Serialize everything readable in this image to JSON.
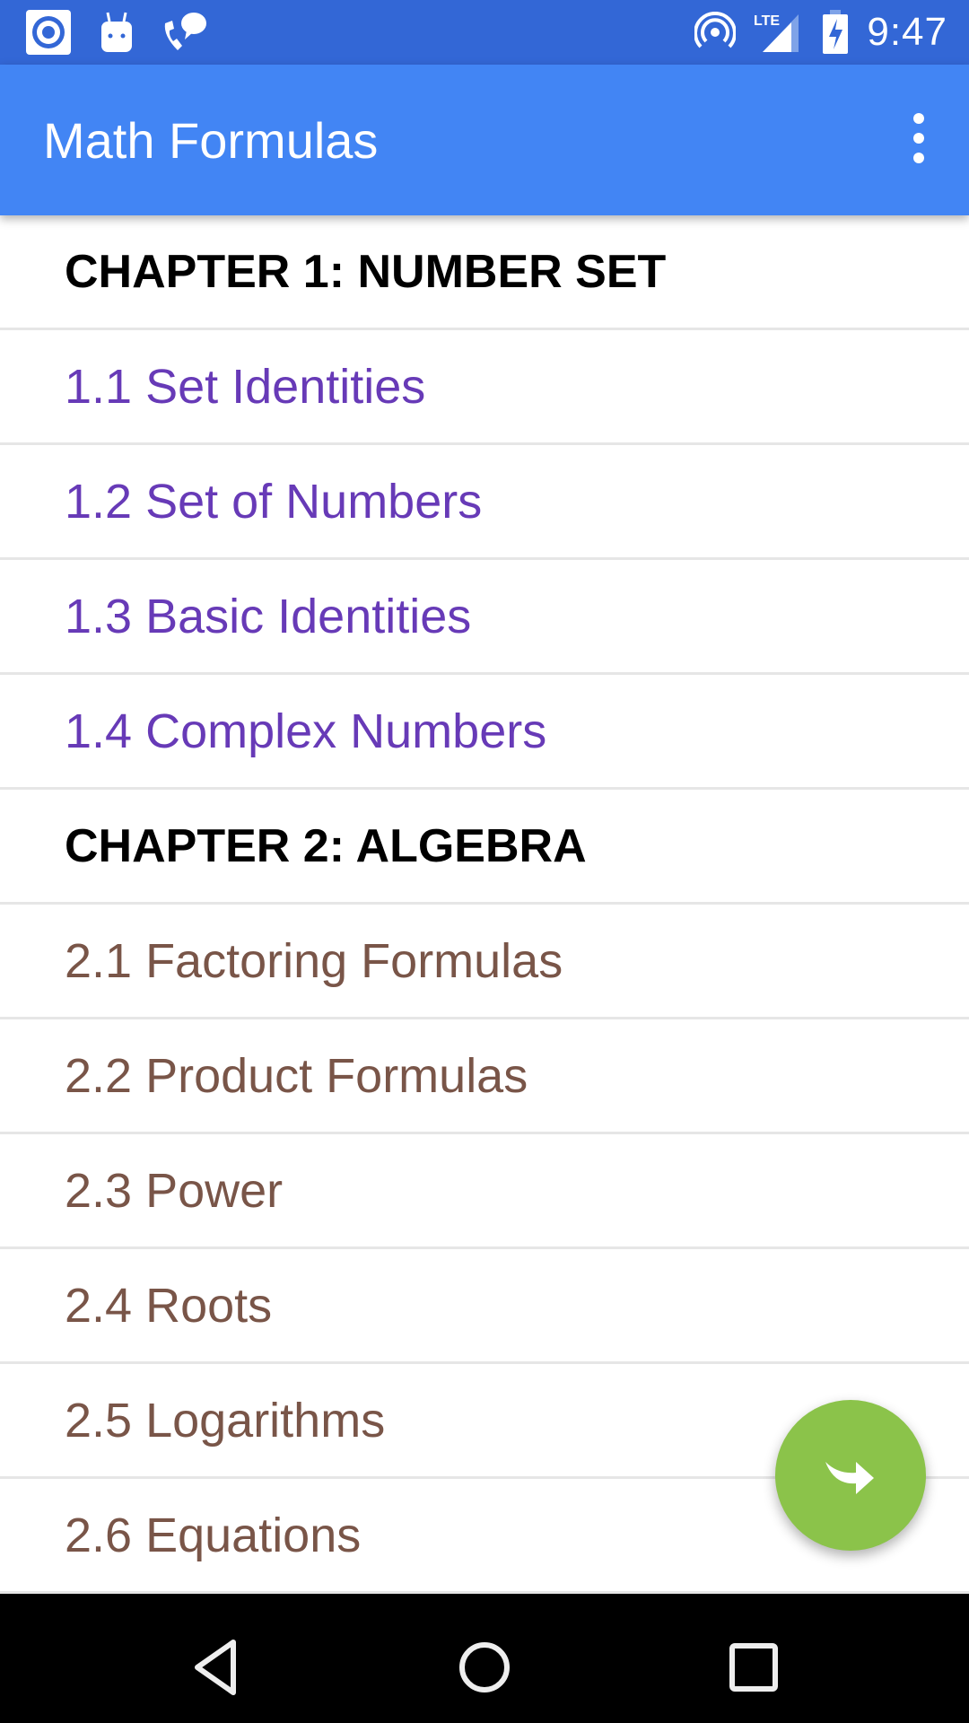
{
  "status_bar": {
    "time": "9:47",
    "left_icons": [
      "notification-target-icon",
      "android-icon",
      "phone-chat-icon"
    ],
    "right_icons": [
      "hotspot-icon",
      "lte-signal-icon",
      "battery-charging-icon"
    ],
    "network_label": "LTE"
  },
  "toolbar": {
    "title": "Math Formulas",
    "overflow_icon": "more-vert-icon"
  },
  "list": {
    "chapter1": {
      "title": "CHAPTER 1:  NUMBER SET",
      "items": [
        "1.1 Set Identities",
        "1.2 Set of Numbers",
        "1.3 Basic Identities",
        "1.4 Complex Numbers"
      ]
    },
    "chapter2": {
      "title": "CHAPTER 2: ALGEBRA",
      "items": [
        "2.1 Factoring Formulas",
        "2.2 Product Formulas",
        "2.3 Power",
        "2.4 Roots",
        "2.5 Logarithms",
        "2.6 Equations"
      ]
    }
  },
  "fab": {
    "icon": "share-forward-icon"
  },
  "nav_bar": {
    "icons": [
      "back-icon",
      "home-icon",
      "recents-icon"
    ]
  },
  "colors": {
    "status_bar": "#3367d6",
    "toolbar": "#4285f4",
    "chapter1_items": "#673ab7",
    "chapter2_items": "#795548",
    "fab": "#8bc34a"
  }
}
